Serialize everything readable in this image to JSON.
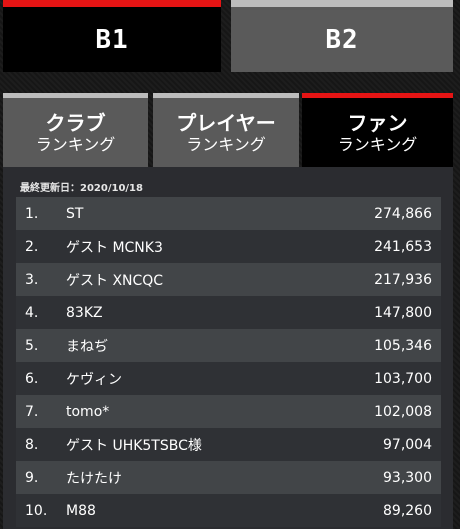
{
  "divisions": [
    {
      "label": "B1",
      "active": true
    },
    {
      "label": "B2",
      "active": false
    }
  ],
  "ranking_tabs": [
    {
      "title": "クラブ",
      "subtitle": "ランキング",
      "active": false
    },
    {
      "title": "プレイヤー",
      "subtitle": "ランキング",
      "active": false
    },
    {
      "title": "ファン",
      "subtitle": "ランキング",
      "active": true
    }
  ],
  "last_updated": "最終更新日：2020/10/18",
  "rankings": [
    {
      "rank": "1.",
      "name": "ST",
      "score": "274,866"
    },
    {
      "rank": "2.",
      "name": "ゲスト MCNK3",
      "score": "241,653"
    },
    {
      "rank": "3.",
      "name": "ゲスト XNCQC",
      "score": "217,936"
    },
    {
      "rank": "4.",
      "name": "83KZ",
      "score": "147,800"
    },
    {
      "rank": "5.",
      "name": "まねぢ",
      "score": "105,346"
    },
    {
      "rank": "6.",
      "name": "ケヴィン",
      "score": "103,700"
    },
    {
      "rank": "7.",
      "name": "tomo*",
      "score": "102,008"
    },
    {
      "rank": "8.",
      "name": "ゲスト UHK5TSBC様",
      "score": "97,004"
    },
    {
      "rank": "9.",
      "name": "たけたけ",
      "score": "93,300"
    },
    {
      "rank": "10.",
      "name": "M88",
      "score": "89,260"
    }
  ],
  "colors": {
    "accent": "#e51414",
    "inactive_tab": "#5a5a5a",
    "active_tab": "#000000"
  }
}
